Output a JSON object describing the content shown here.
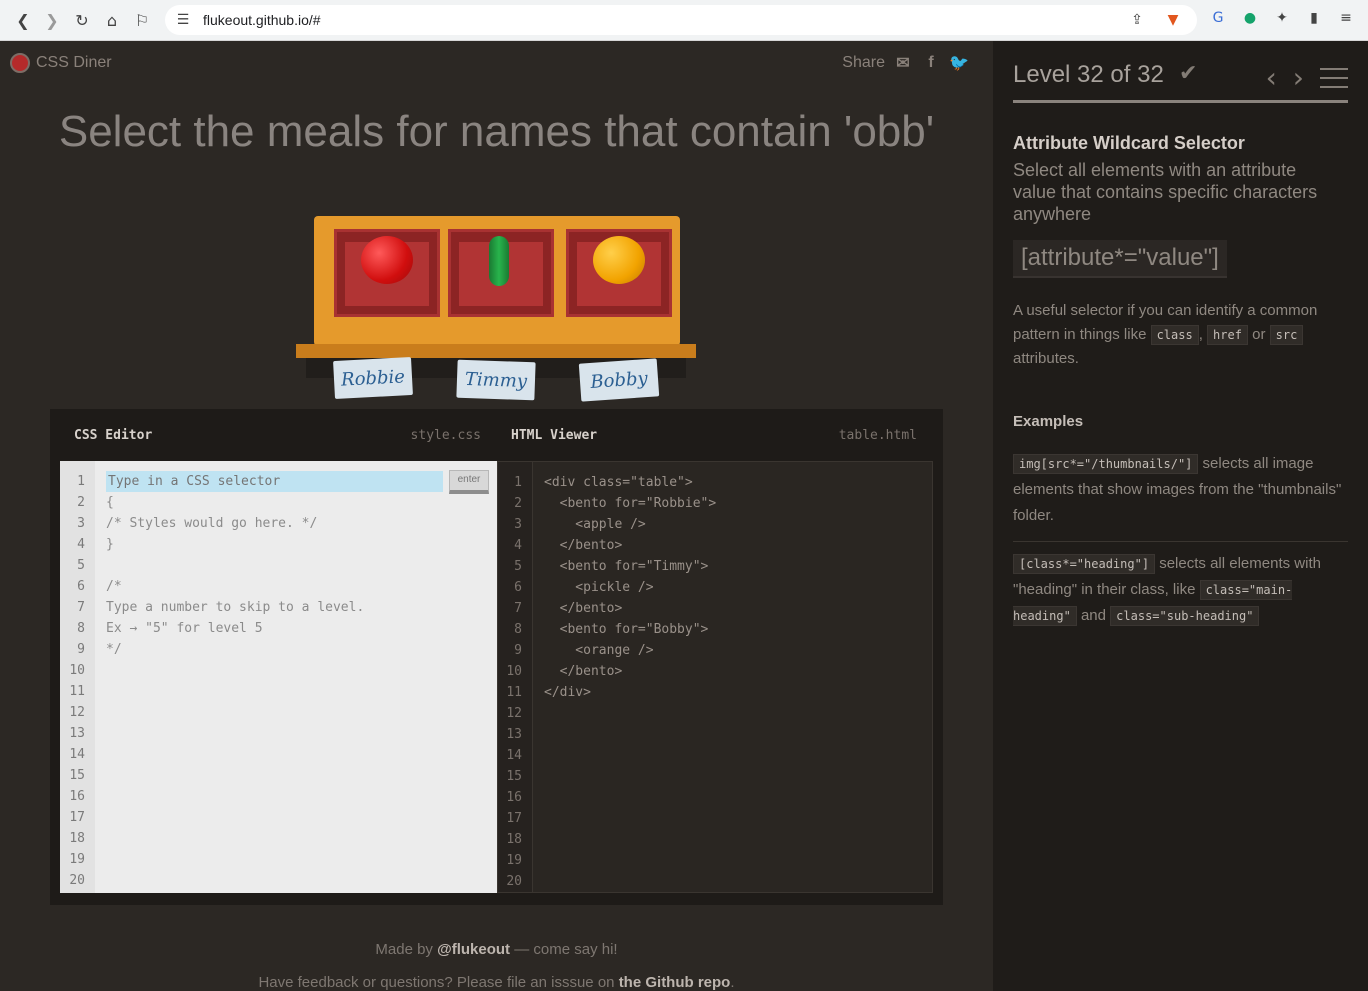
{
  "browser": {
    "url": "flukeout.github.io/#"
  },
  "app": {
    "logo_text": "CSS Diner",
    "share_label": "Share",
    "instruction": "Select the meals for names that contain 'obb'"
  },
  "table": {
    "bentos": [
      {
        "name": "Robbie",
        "food": "apple"
      },
      {
        "name": "Timmy",
        "food": "pickle"
      },
      {
        "name": "Bobby",
        "food": "orange"
      }
    ]
  },
  "css_editor": {
    "title": "CSS Editor",
    "file": "style.css",
    "placeholder": "Type in a CSS selector",
    "enter_label": "enter",
    "lines": [
      "",
      "{",
      "/* Styles would go here. */",
      "}",
      "",
      "/*",
      "Type a number to skip to a level.",
      "Ex → \"5\" for level 5",
      "*/"
    ],
    "line_numbers": [
      "1",
      "2",
      "3",
      "4",
      "5",
      "6",
      "7",
      "8",
      "9",
      "10",
      "11",
      "12",
      "13",
      "14",
      "15",
      "16",
      "17",
      "18",
      "19",
      "20"
    ]
  },
  "html_viewer": {
    "title": "HTML Viewer",
    "file": "table.html",
    "lines": [
      "<div class=\"table\">",
      "  <bento for=\"Robbie\">",
      "    <apple />",
      "  </bento>",
      "  <bento for=\"Timmy\">",
      "    <pickle />",
      "  </bento>",
      "  <bento for=\"Bobby\">",
      "    <orange />",
      "  </bento>",
      "</div>"
    ],
    "line_numbers": [
      "1",
      "2",
      "3",
      "4",
      "5",
      "6",
      "7",
      "8",
      "9",
      "10",
      "11",
      "12",
      "13",
      "14",
      "15",
      "16",
      "17",
      "18",
      "19",
      "20"
    ]
  },
  "footer": {
    "made_by_prefix": "Made by ",
    "made_by_handle": "@flukeout",
    "made_by_suffix": " — come say hi!",
    "feedback_prefix": "Have feedback or questions? Please file an isssue on ",
    "feedback_link": "the Github repo",
    "feedback_suffix": "."
  },
  "sidebar": {
    "level_title": "Level 32 of 32",
    "progress": 1.0,
    "selector_name": "Attribute Wildcard Selector",
    "selector_title": "Select all elements with an attribute value that contains specific characters anywhere",
    "syntax": "[attribute*=\"value\"]",
    "hint_prefix": "A useful selector if you can identify a common pattern in things like ",
    "hint_code_1": "class",
    "hint_sep_1": ", ",
    "hint_code_2": "href",
    "hint_sep_2": " or ",
    "hint_code_3": "src",
    "hint_suffix": " attributes.",
    "examples_title": "Examples",
    "example_1_code": "img[src*=\"/thumbnails/\"]",
    "example_1_text": " selects all image elements that show images from the \"thumbnails\" folder.",
    "example_2_code": "[class*=\"heading\"]",
    "example_2_text_a": " selects all elements with \"heading\" in their class, like ",
    "example_2_code_b": "class=\"main-heading\"",
    "example_2_text_c": " and ",
    "example_2_code_d": "class=\"sub-heading\""
  }
}
